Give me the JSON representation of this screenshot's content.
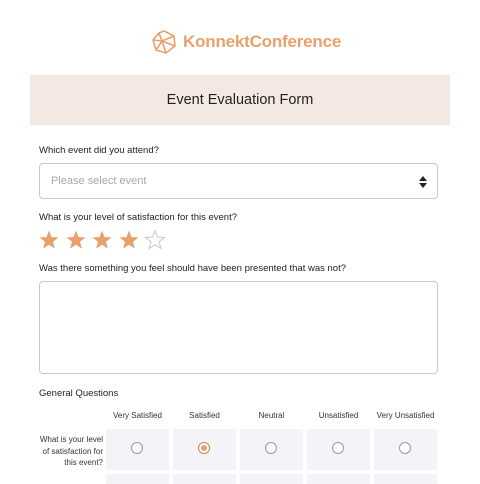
{
  "brand": {
    "name": "KonnektConference",
    "logo_icon": "geodesic-logo-icon",
    "color": "#e8a16c"
  },
  "form": {
    "title": "Event Evaluation Form"
  },
  "questions": {
    "event": {
      "label": "Which event did you attend?",
      "placeholder": "Please select event"
    },
    "satisfaction": {
      "label": "What is your level of satisfaction for this event?",
      "rating": 4,
      "max": 5
    },
    "missing": {
      "label": "Was there something you feel should have been presented that was not?",
      "value": ""
    }
  },
  "general": {
    "title": "General Questions",
    "columns": [
      "Very Satisfied",
      "Satisfied",
      "Neutral",
      "Unsatisfied",
      "Very Unsatisfied"
    ],
    "rows": [
      {
        "label": "What is your level of satisfaction for this event?",
        "selected_index": 1
      }
    ]
  },
  "colors": {
    "accent": "#e8a16c",
    "header_band": "#f4e8e3",
    "star_filled": "#e8a06d",
    "star_empty": "#c8c8c8"
  }
}
